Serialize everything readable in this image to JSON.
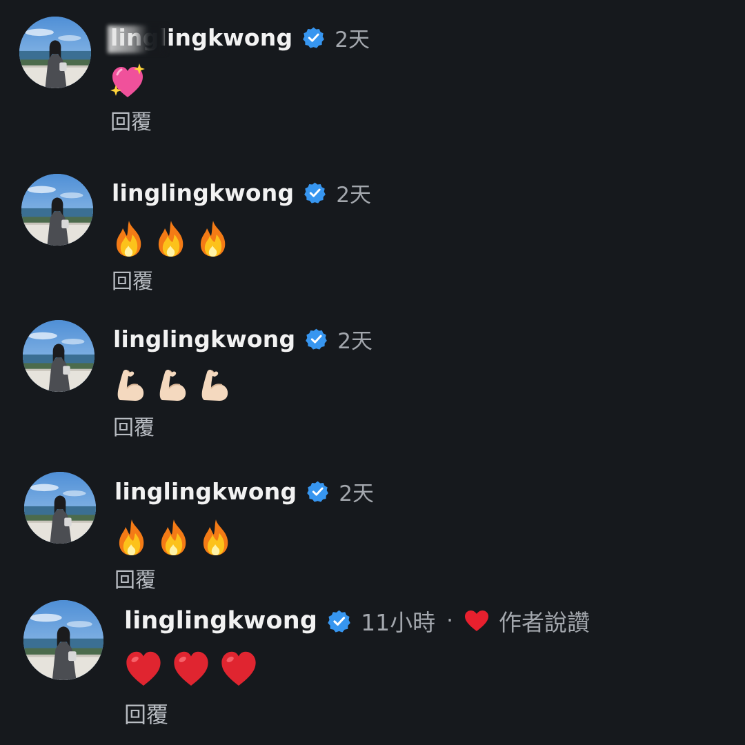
{
  "colors": {
    "background": "#16191d",
    "verified_blue": "#3796f0",
    "meta_gray": "#a3a7ad",
    "heart_red": "#e8202e"
  },
  "comments": [
    {
      "username": "linglingkwong",
      "time": "2天",
      "emoji_icons": [
        "sparkling-heart"
      ],
      "reply_label": "回覆",
      "username_partially_obscured": true
    },
    {
      "username": "linglingkwong",
      "time": "2天",
      "emoji_icons": [
        "fire",
        "fire",
        "fire"
      ],
      "reply_label": "回覆"
    },
    {
      "username": "linglingkwong",
      "time": "2天",
      "emoji_icons": [
        "flexed-biceps",
        "flexed-biceps",
        "flexed-biceps"
      ],
      "reply_label": "回覆"
    },
    {
      "username": "linglingkwong",
      "time": "2天",
      "emoji_icons": [
        "fire",
        "fire",
        "fire"
      ],
      "reply_label": "回覆"
    },
    {
      "username": "linglingkwong",
      "time": "11小時",
      "separator": "·",
      "liked_by_author": "作者說讚",
      "emoji_icons": [
        "red-heart",
        "red-heart",
        "red-heart"
      ],
      "reply_label": "回覆"
    }
  ]
}
